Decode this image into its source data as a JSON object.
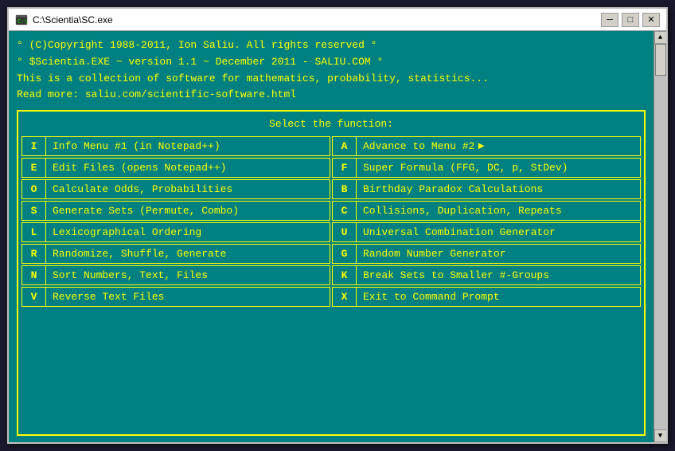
{
  "window": {
    "title": "C:\\Scientia\\SC.exe",
    "icon": "terminal"
  },
  "titlebar": {
    "minimize_label": "─",
    "maximize_label": "□",
    "close_label": "✕"
  },
  "header": {
    "line1": "° (C)Copyright 1988-2011, Ion Saliu. All rights reserved  °",
    "line2": "° $Scientia.EXE ~ version 1.1 ~ December 2011 - SALIU.COM °",
    "line3": "This is a collection of software for mathematics, probability, statistics...",
    "line4": "Read more: saliu.com/scientific-software.html"
  },
  "menu": {
    "title": "Select the function:",
    "left_items": [
      {
        "key": "I",
        "label": "Info Menu #1 (in Notepad++)"
      },
      {
        "key": "E",
        "label": "Edit Files (opens Notepad++)"
      },
      {
        "key": "O",
        "label": "Calculate Odds, Probabilities"
      },
      {
        "key": "S",
        "label": "Generate Sets (Permute, Combo)"
      },
      {
        "key": "L",
        "label": "Lexicographical Ordering"
      },
      {
        "key": "R",
        "label": "Randomize, Shuffle, Generate"
      },
      {
        "key": "N",
        "label": "Sort Numbers, Text, Files"
      },
      {
        "key": "V",
        "label": "Reverse Text Files"
      }
    ],
    "right_items": [
      {
        "key": "A",
        "label": "Advance to Menu #2",
        "arrow": true
      },
      {
        "key": "F",
        "label": "Super Formula (FFG, DC, p, StDev)"
      },
      {
        "key": "B",
        "label": "Birthday Paradox Calculations"
      },
      {
        "key": "C",
        "label": "Collisions, Duplication, Repeats"
      },
      {
        "key": "U",
        "label": "Universal Combination Generator"
      },
      {
        "key": "G",
        "label": "Random Number Generator"
      },
      {
        "key": "K",
        "label": "Break Sets to Smaller #-Groups"
      },
      {
        "key": "X",
        "label": "Exit to Command Prompt"
      }
    ]
  },
  "scrollbar": {
    "up_arrow": "▲",
    "down_arrow": "▼"
  }
}
